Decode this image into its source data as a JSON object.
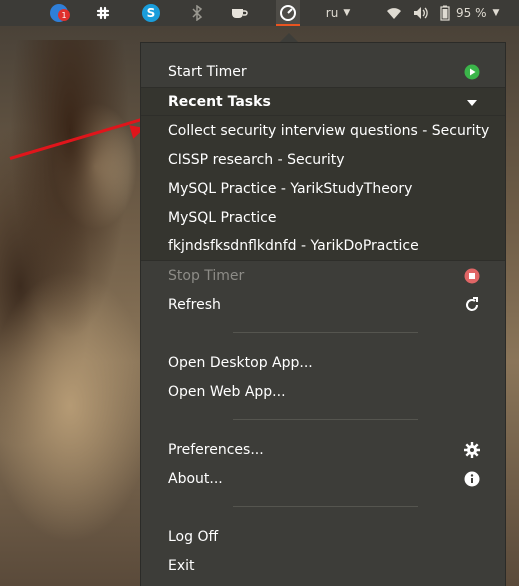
{
  "panel": {
    "notification_badge": "1",
    "language": "ru",
    "battery": "95 %"
  },
  "menu": {
    "start_timer": "Start Timer",
    "recent_tasks_header": "Recent Tasks",
    "recent_tasks": [
      "Collect security interview questions - Security",
      "CISSP research - Security",
      "MySQL Practice - YarikStudyTheory",
      "MySQL Practice",
      "fkjndsfksdnflkdnfd - YarikDoPractice"
    ],
    "stop_timer": "Stop Timer",
    "refresh": "Refresh",
    "open_desktop_app": "Open Desktop App...",
    "open_web_app": "Open Web App...",
    "preferences": "Preferences...",
    "about": "About...",
    "log_off": "Log Off",
    "exit": "Exit"
  },
  "colors": {
    "start_green": "#3bb54a",
    "stop_red": "#e06666",
    "panel_bg": "#3c3b37",
    "menu_bg": "#3d3d39",
    "accent_orange": "#e95420"
  }
}
